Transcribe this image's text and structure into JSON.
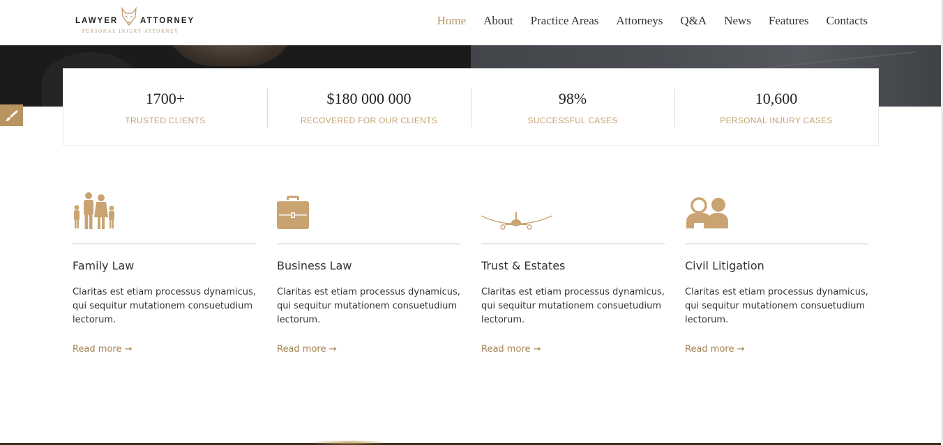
{
  "logo": {
    "word_left": "LAWYER",
    "word_right": "ATTORNEY",
    "tagline": "PERSONAL INJURY ATTORNEY",
    "icon": "fox-icon"
  },
  "nav": {
    "items": [
      {
        "label": "Home",
        "active": true
      },
      {
        "label": "About",
        "active": false
      },
      {
        "label": "Practice Areas",
        "active": false
      },
      {
        "label": "Attorneys",
        "active": false
      },
      {
        "label": "Q&A",
        "active": false
      },
      {
        "label": "News",
        "active": false
      },
      {
        "label": "Features",
        "active": false
      },
      {
        "label": "Contacts",
        "active": false
      }
    ]
  },
  "side_tab": {
    "icon": "paintbrush-icon"
  },
  "stats": [
    {
      "value": "1700+",
      "label": "TRUSTED CLIENTS"
    },
    {
      "value": "$180 000 000",
      "label": "RECOVERED FOR OUR CLIENTS"
    },
    {
      "value": "98%",
      "label": "SUCCESSFUL CASES"
    },
    {
      "value": "10,600",
      "label": "PERSONAL INJURY CASES"
    }
  ],
  "practice_areas": [
    {
      "icon": "family-icon",
      "title": "Family Law",
      "text": "Claritas est etiam processus dynamicus, qui sequitur mutationem consuetudium lectorum.",
      "link": "Read more →"
    },
    {
      "icon": "briefcase-icon",
      "title": "Business Law",
      "text": "Claritas est etiam processus dynamicus, qui sequitur mutationem consuetudium lectorum.",
      "link": "Read more →"
    },
    {
      "icon": "airplane-icon",
      "title": "Trust & Estates",
      "text": "Claritas est etiam processus dynamicus, qui sequitur mutationem consuetudium lectorum.",
      "link": "Read more →"
    },
    {
      "icon": "people-icon",
      "title": "Civil Litigation",
      "text": "Claritas est etiam processus dynamicus, qui sequitur mutationem consuetudium lectorum.",
      "link": "Read more →"
    }
  ],
  "colors": {
    "accent": "#b89461",
    "stat_label": "#c6a374",
    "link": "#a3804f",
    "text": "#333333"
  }
}
